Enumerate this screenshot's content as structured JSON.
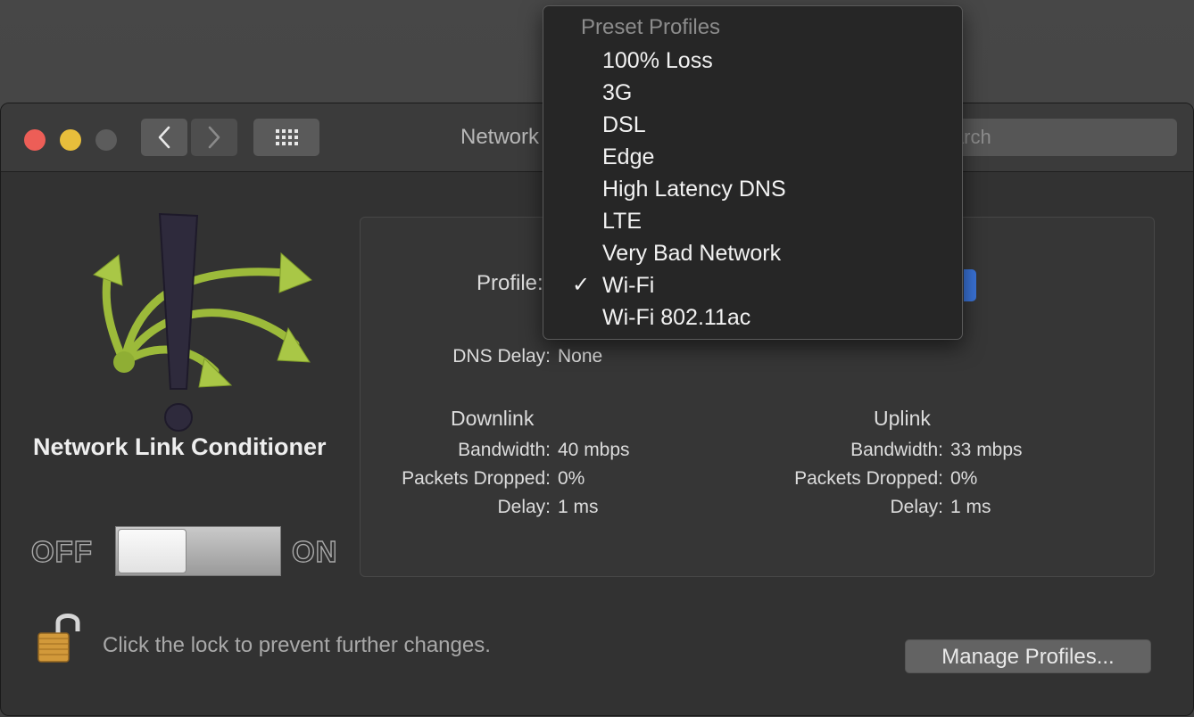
{
  "window": {
    "title": "Network",
    "search_placeholder": "Search"
  },
  "app": {
    "name": "Network Link Conditioner"
  },
  "switch": {
    "off_label": "OFF",
    "on_label": "ON"
  },
  "profile": {
    "label": "Profile:"
  },
  "dns": {
    "label": "DNS Delay:",
    "value": "None"
  },
  "downlink": {
    "title": "Downlink",
    "bandwidth_label": "Bandwidth:",
    "bandwidth_value": "40 mbps",
    "packets_label": "Packets Dropped:",
    "packets_value": "0%",
    "delay_label": "Delay:",
    "delay_value": "1 ms"
  },
  "uplink": {
    "title": "Uplink",
    "bandwidth_label": "Bandwidth:",
    "bandwidth_value": "33 mbps",
    "packets_label": "Packets Dropped:",
    "packets_value": "0%",
    "delay_label": "Delay:",
    "delay_value": "1 ms"
  },
  "lock": {
    "text": "Click the lock to prevent further changes."
  },
  "buttons": {
    "manage_profiles": "Manage Profiles..."
  },
  "menu": {
    "header": "Preset Profiles",
    "check_glyph": "✓",
    "items": [
      {
        "label": "100% Loss"
      },
      {
        "label": "3G"
      },
      {
        "label": "DSL"
      },
      {
        "label": "Edge"
      },
      {
        "label": "High Latency DNS"
      },
      {
        "label": "LTE"
      },
      {
        "label": "Very Bad Network"
      },
      {
        "label": "Wi-Fi"
      },
      {
        "label": "Wi-Fi 802.11ac"
      }
    ]
  },
  "colors": {
    "close": "#ed5e57",
    "minimize": "#e8be3b",
    "popup_accent": "#3a73d7",
    "logo_arrow": "#9cba3a"
  }
}
